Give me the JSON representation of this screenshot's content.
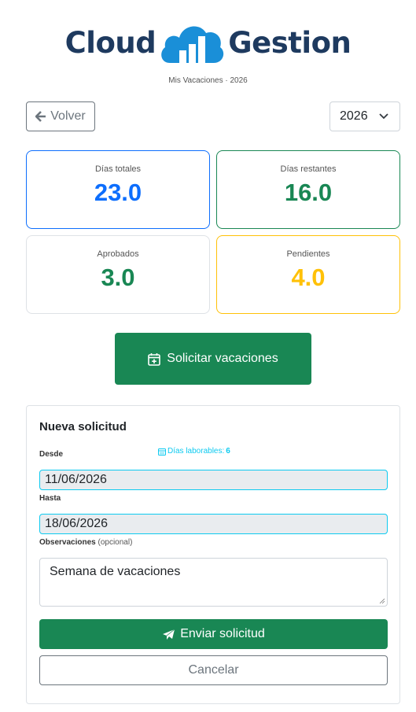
{
  "brand": {
    "left": "Cloud",
    "right": "Gestion",
    "colors": {
      "navy": "#1e3a5f",
      "cloud": "#1a8fd8"
    }
  },
  "header": {
    "subtitle": "Mis Vacaciones · 2026"
  },
  "toolbar": {
    "back_label": "Volver",
    "back_icon": "arrow-left-icon",
    "year_value": "2026",
    "year_icon": "chevron-down-icon"
  },
  "stats": [
    {
      "label": "Días totales",
      "value": "23.0",
      "color": "#0d6efd"
    },
    {
      "label": "Días restantes",
      "value": "16.0",
      "color": "#198754"
    },
    {
      "label": "Aprobados",
      "value": "3.0",
      "color": "#198754"
    },
    {
      "label": "Pendientes",
      "value": "4.0",
      "color": "#ffc107"
    }
  ],
  "request_button": {
    "label": "Solicitar vacaciones",
    "icon": "calendar-plus-icon"
  },
  "form": {
    "title": "Nueva solicitud",
    "from_label": "Desde",
    "working_days_label": "Días laborables:",
    "working_days_value": "6",
    "working_days_icon": "calendar-icon",
    "from_value": "11/06/2026",
    "to_label": "Hasta",
    "to_value": "18/06/2026",
    "notes_label": "Observaciones",
    "notes_optional": "(opcional)",
    "notes_value": "Semana de vacaciones",
    "send_label": "Enviar solicitud",
    "send_icon": "paper-plane-icon",
    "cancel_label": "Cancelar"
  },
  "colors": {
    "success": "#198754",
    "primary": "#0d6efd",
    "warning": "#ffc107",
    "info": "#0dcaf0",
    "secondary": "#6c757d"
  }
}
